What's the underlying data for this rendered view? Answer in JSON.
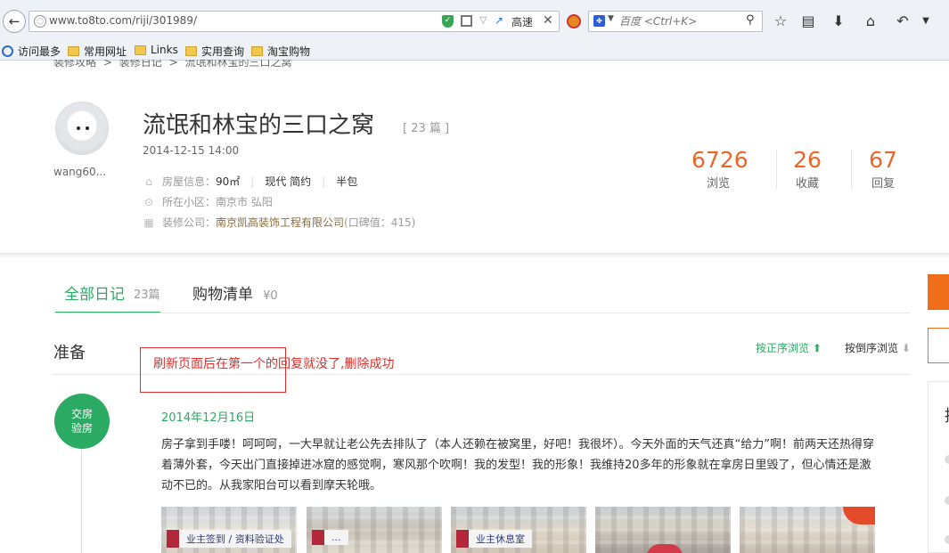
{
  "browser": {
    "url": "www.to8to.com/riji/301989/",
    "speed_label": "高速",
    "search_placeholder": "百度 <Ctrl+K>",
    "bookmarks": [
      {
        "label": "访问最多"
      },
      {
        "label": "常用网址"
      },
      {
        "label": "Links"
      },
      {
        "label": "实用查询"
      },
      {
        "label": "淘宝购物"
      }
    ]
  },
  "breadcrumb": [
    "装修攻略",
    ">",
    "装修日记",
    ">",
    "流氓和林宝的三口之窝"
  ],
  "profile": {
    "username": "wang60...",
    "title": "流氓和林宝的三口之窝",
    "count_label": "[ 23 篇 ]",
    "date": "2014-12-15 14:00",
    "house_label": "房屋信息：",
    "house_area": "90㎡",
    "house_style": "现代 简约",
    "house_type": "半包",
    "community_label": "所在小区：",
    "community": "南京市 弘阳",
    "company_label": "装修公司：",
    "company": "南京凯高装饰工程有限公司",
    "company_score": "(口碑值：415)"
  },
  "stats": [
    {
      "value": "6726",
      "label": "浏览"
    },
    {
      "value": "26",
      "label": "收藏"
    },
    {
      "value": "67",
      "label": "回复"
    }
  ],
  "tabs": [
    {
      "label": "全部日记",
      "count": "23篇"
    },
    {
      "label": "购物清单",
      "count": "¥0"
    }
  ],
  "section": {
    "title": "准备",
    "sort_asc": "按正序浏览 ⬆",
    "sort_desc": "按倒序浏览",
    "sort_desc_arrow": "⬇"
  },
  "annotation": "刷新页面后在第一个的回复就没了,删除成功",
  "entry": {
    "stage_line1": "交房",
    "stage_line2": "验房",
    "date": "2014年12月16日",
    "body": "房子拿到手喽！呵呵呵，一大早就让老公先去排队了（本人还赖在被窝里，好吧！我很坏）。今天外面的天气还真“给力”啊！前两天还热得穿着薄外套，今天出门直接掉进冰窟的感觉啊，寒风那个吹啊！我的发型！我的形象！我维持20多年的形象就在拿房日里毁了，但心情还是激动不已的。从我家阳台可以看到摩天轮哦。",
    "photo_signs": [
      "业主签到 / 资料验证处",
      "...",
      "业主休息室"
    ]
  },
  "side_panel_char": "提",
  "colors": {
    "accent_green": "#2aaa63",
    "stat_orange": "#e8672a",
    "annotation_red": "#d9302c"
  }
}
